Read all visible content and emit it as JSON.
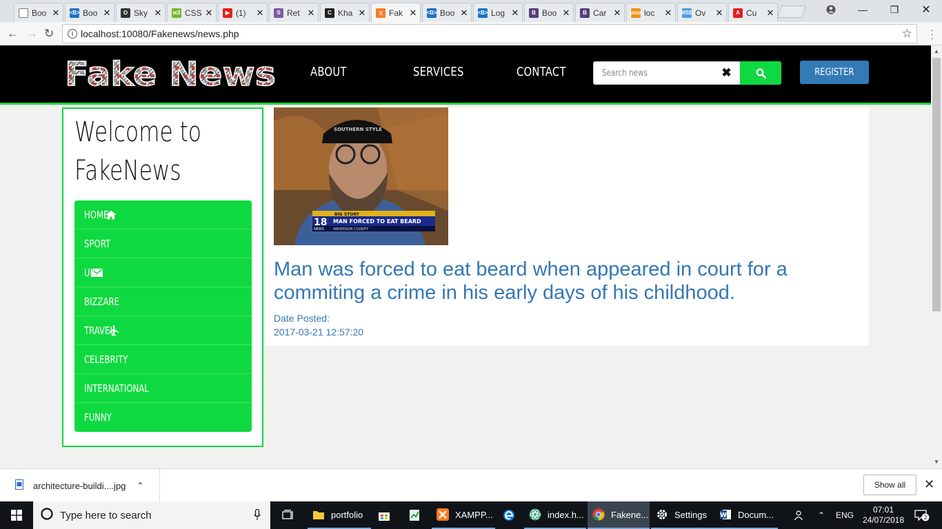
{
  "browser": {
    "tabs": [
      {
        "label": "Boo",
        "icon": "document-icon",
        "color": "#ffffff",
        "text": "",
        "active": false
      },
      {
        "label": "Boo",
        "icon": "bootstrap-blue-icon",
        "color": "#1a73c9",
        "text": "<B>",
        "active": false
      },
      {
        "label": "Sky",
        "icon": "sky-icon",
        "color": "#333333",
        "text": "O",
        "active": false
      },
      {
        "label": "CSS",
        "icon": "w3-icon",
        "color": "#7cb32b",
        "text": "w3",
        "active": false
      },
      {
        "label": "(1)",
        "icon": "youtube-icon",
        "color": "#e62117",
        "text": "▶",
        "active": false
      },
      {
        "label": "Ret",
        "icon": "ret-icon",
        "color": "#7b5aa6",
        "text": "S",
        "active": false
      },
      {
        "label": "Kha",
        "icon": "k-icon",
        "color": "#222222",
        "text": "C",
        "active": false
      },
      {
        "label": "Fak",
        "icon": "xampp-icon",
        "color": "#fb7a24",
        "text": "X",
        "active": true
      },
      {
        "label": "Boo",
        "icon": "bootstrap-blue-icon",
        "color": "#1a73c9",
        "text": "<B>",
        "active": false
      },
      {
        "label": "Log",
        "icon": "bootstrap-blue-icon",
        "color": "#1a73c9",
        "text": "<B>",
        "active": false
      },
      {
        "label": "Boo",
        "icon": "bootstrap-purple-icon",
        "color": "#563d7c",
        "text": "B",
        "active": false
      },
      {
        "label": "Car",
        "icon": "bootstrap-purple-icon",
        "color": "#563d7c",
        "text": "B",
        "active": false
      },
      {
        "label": "loc",
        "icon": "pma-icon",
        "color": "#f29111",
        "text": "pma",
        "active": false
      },
      {
        "label": "Ov",
        "icon": "msb-icon",
        "color": "#4c9be8",
        "text": "MSB",
        "active": false
      },
      {
        "label": "Cu",
        "icon": "adobe-icon",
        "color": "#e51d1d",
        "text": "A",
        "active": false
      }
    ],
    "url": "localhost:10080/Fakenews/news.php"
  },
  "site": {
    "logo_alt": "Fake News",
    "nav": {
      "about": "ABOUT",
      "services": "SERVICES",
      "contact": "CONTACT"
    },
    "search": {
      "placeholder": "Search news",
      "clear": "✖"
    },
    "register": "REGISTER",
    "welcome_line1": "Welcome to",
    "welcome_line2": "FakeNews",
    "categories": [
      {
        "label": "HOME",
        "icon": "home-icon"
      },
      {
        "label": "SPORT",
        "icon": ""
      },
      {
        "label": "UK",
        "icon": "envelope-icon"
      },
      {
        "label": "BIZZARE",
        "icon": ""
      },
      {
        "label": "TRAVEL",
        "icon": "plane-icon"
      },
      {
        "label": "CELEBRITY",
        "icon": ""
      },
      {
        "label": "INTERNATIONAL",
        "icon": ""
      },
      {
        "label": "FUNNY",
        "icon": ""
      }
    ],
    "article": {
      "title": "Man was forced to eat beard when appeared in court for a commiting a crime in his early days of his childhood.",
      "date_label": "Date Posted:",
      "date_value": "2017-03-21 12:57:20",
      "image_caption_top": "BIG STORY",
      "image_caption": "MAN FORCED TO EAT BEARD",
      "image_caption_sub": "ANDERSON COUNTY",
      "image_channel": "18",
      "image_news": "NEWS",
      "cap_text": "SOUTHERN STYLE"
    }
  },
  "downloads": {
    "file": "architecture-buildi....jpg",
    "show_all": "Show all"
  },
  "taskbar": {
    "search_placeholder": "Type here to search",
    "apps": [
      {
        "label": "portfolio",
        "icon": "folder-icon"
      },
      {
        "label": "XAMPP...",
        "icon": "xampp-icon"
      },
      {
        "label": "index.h...",
        "icon": "atom-icon"
      },
      {
        "label": "Fakene...",
        "icon": "chrome-icon"
      },
      {
        "label": "Settings",
        "icon": "gear-icon"
      },
      {
        "label": "Docum...",
        "icon": "word-icon"
      }
    ],
    "lang": "ENG",
    "time": "07:01",
    "date": "24/07/2018",
    "notifications": "2"
  }
}
